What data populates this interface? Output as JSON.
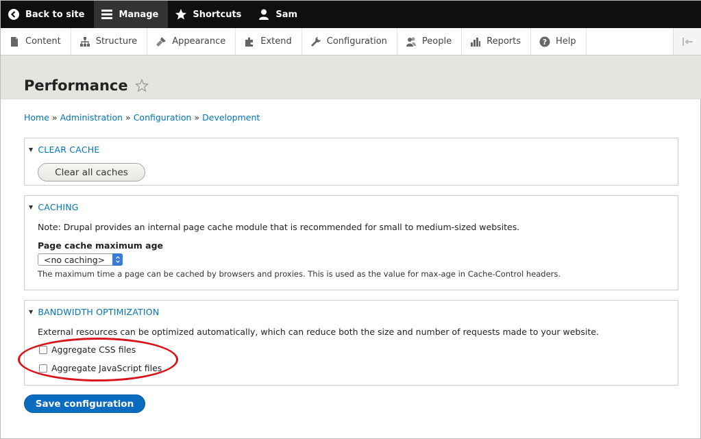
{
  "toolbar": {
    "back": "Back to site",
    "manage": "Manage",
    "shortcuts": "Shortcuts",
    "user": "Sam"
  },
  "tray": {
    "items": [
      "Content",
      "Structure",
      "Appearance",
      "Extend",
      "Configuration",
      "People",
      "Reports",
      "Help"
    ]
  },
  "page": {
    "title": "Performance"
  },
  "breadcrumb": {
    "items": [
      "Home",
      "Administration",
      "Configuration",
      "Development"
    ],
    "separator": "»"
  },
  "clear_cache": {
    "legend": "CLEAR CACHE",
    "button": "Clear all caches"
  },
  "caching": {
    "legend": "CACHING",
    "note": "Note: Drupal provides an internal page cache module that is recommended for small to medium-sized websites.",
    "field_label": "Page cache maximum age",
    "select_value": "<no caching>",
    "description": "The maximum time a page can be cached by browsers and proxies. This is used as the value for max-age in Cache-Control headers."
  },
  "bandwidth": {
    "legend": "BANDWIDTH OPTIMIZATION",
    "note": "External resources can be optimized automatically, which can reduce both the size and number of requests made to your website.",
    "css_label": "Aggregate CSS files",
    "css_checked": false,
    "js_label": "Aggregate JavaScript files",
    "js_checked": false
  },
  "actions": {
    "save": "Save configuration"
  },
  "colors": {
    "link": "#0074bd",
    "primary_button": "#0a6cc0",
    "highlight_oval": "#d9141b"
  }
}
